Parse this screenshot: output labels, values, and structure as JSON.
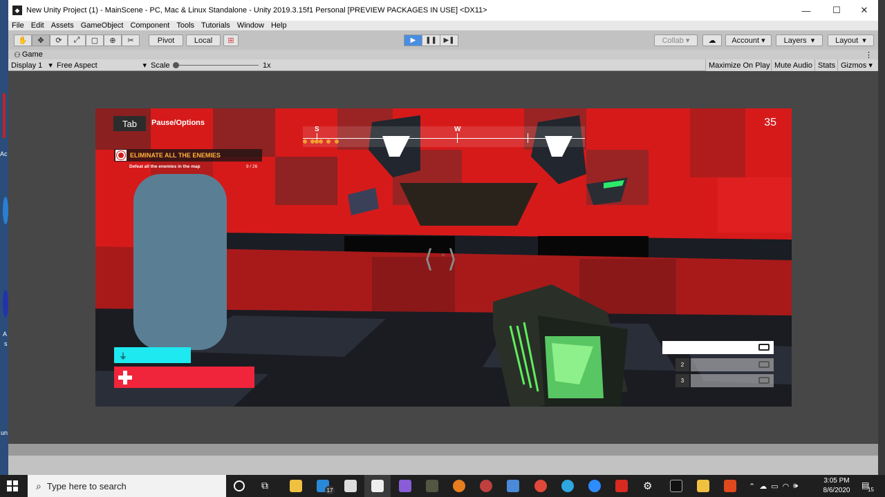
{
  "window": {
    "title": "New Unity Project (1) - MainScene - PC, Mac & Linux Standalone - Unity 2019.3.15f1 Personal [PREVIEW PACKAGES IN USE] <DX11>",
    "minimize": "—",
    "maximize": "☐",
    "close": "✕"
  },
  "menu": [
    "File",
    "Edit",
    "Assets",
    "GameObject",
    "Component",
    "Tools",
    "Tutorials",
    "Window",
    "Help"
  ],
  "toolbar": {
    "tools": [
      "✋",
      "✥",
      "⟳",
      "⤢",
      "▢",
      "⊕",
      "✂"
    ],
    "pivot": "Pivot",
    "local": "Local",
    "collab": "Collab",
    "account": "Account",
    "layers": "Layers",
    "layout": "Layout"
  },
  "game_tab": {
    "label": "Game"
  },
  "game_bar": {
    "display": "Display 1",
    "aspect": "Free Aspect",
    "scale_label": "Scale",
    "scale_value": "1x",
    "maximize": "Maximize On Play",
    "mute": "Mute Audio",
    "stats": "Stats",
    "gizmos": "Gizmos"
  },
  "hud": {
    "tab_key": "Tab",
    "pause_label": "Pause/Options",
    "score": "35",
    "objective_title": "ELIMINATE ALL THE ENEMIES",
    "objective_desc": "Defeat all the enemies in the map",
    "objective_count": "9 / 26",
    "compass_s": "S",
    "compass_w": "W",
    "jetpack_fill": 1.0,
    "health_fill": 1.0,
    "slot2": "2",
    "slot3": "3"
  },
  "taskbar": {
    "search_placeholder": "Type here to search",
    "mail_badge": "17",
    "time": "3:05 PM",
    "date": "8/6/2020",
    "notif": "15"
  },
  "desktop": {
    "label_ac": "Ac",
    "label_a": "A",
    "label_s": "s",
    "label_un": "un"
  },
  "colors": {
    "game_red": "#d21a1a",
    "health": "#f0243a",
    "jetpack": "#1ee8f0",
    "objective_accent": "#ffb43a",
    "play_active": "#4a8ee0"
  }
}
